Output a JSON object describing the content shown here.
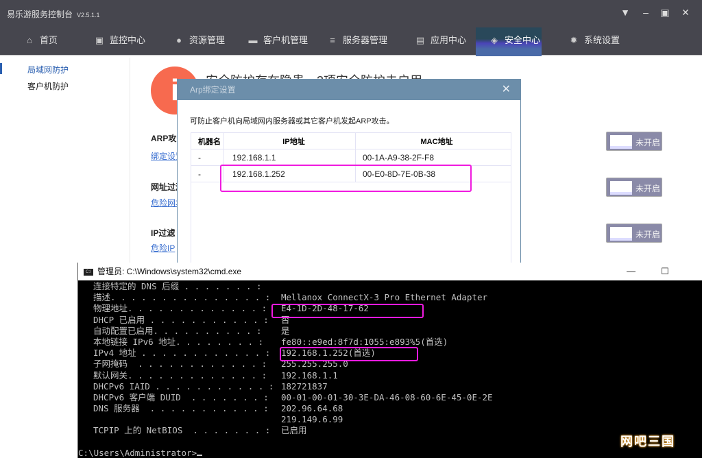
{
  "app": {
    "title": "易乐游服务控制台",
    "version": "V2.5.1.1"
  },
  "nav": [
    {
      "label": "首页",
      "icon": "home-icon"
    },
    {
      "label": "监控中心",
      "icon": "monitor-chart-icon"
    },
    {
      "label": "资源管理",
      "icon": "robot-icon"
    },
    {
      "label": "客户机管理",
      "icon": "computer-icon"
    },
    {
      "label": "服务器管理",
      "icon": "server-icon"
    },
    {
      "label": "应用中心",
      "icon": "bag-icon"
    },
    {
      "label": "安全中心",
      "icon": "shield-icon",
      "active": true
    },
    {
      "label": "系统设置",
      "icon": "gear-icon"
    }
  ],
  "sidebar": [
    {
      "label": "局域网防护",
      "active": true
    },
    {
      "label": "客户机防护"
    }
  ],
  "main": {
    "warning": "安全防护存在隐患，3项安全防护未启用",
    "sections": [
      {
        "title": "ARP攻击防护",
        "link": "绑定设置",
        "toggle": "未开启"
      },
      {
        "title": "网址过滤",
        "link": "危险网址",
        "toggle": "未开启"
      },
      {
        "title": "IP过滤",
        "link": "危险IP",
        "toggle": "未开启"
      }
    ]
  },
  "dialog": {
    "title": "Arp绑定设置",
    "close": "✕",
    "description": "可防止客户机向局域网内服务器或其它客户机发起ARP攻击。",
    "columns": [
      "机器名",
      "IP地址",
      "MAC地址"
    ],
    "rows": [
      {
        "name": "-",
        "ip": "192.168.1.1",
        "mac": "00-1A-A9-38-2F-F8"
      },
      {
        "name": "-",
        "ip": "192.168.1.252",
        "mac": "00-E0-8D-7E-0B-38"
      }
    ]
  },
  "cmd": {
    "title": "管理员: C:\\Windows\\system32\\cmd.exe",
    "lines": [
      {
        "k": "连接特定的 DNS 后缀 . . . . . . . :",
        "v": ""
      },
      {
        "k": "描述. . . . . . . . . . . . . . . :",
        "v": "Mellanox ConnectX-3 Pro Ethernet Adapter"
      },
      {
        "k": "物理地址. . . . . . . . . . . . . :",
        "v": "E4-1D-2D-48-17-62"
      },
      {
        "k": "DHCP 已启用 . . . . . . . . . . . :",
        "v": "否"
      },
      {
        "k": "自动配置已启用. . . . . . . . . . :",
        "v": "是"
      },
      {
        "k": "本地链接 IPv6 地址. . . . . . . . :",
        "v": "fe80::e9ed:8f7d:1055:e893%5(首选)"
      },
      {
        "k": "IPv4 地址 . . . . . . . . . . . . :",
        "v": "192.168.1.252(首选)"
      },
      {
        "k": "子网掩码  . . . . . . . . . . . . :",
        "v": "255.255.255.0"
      },
      {
        "k": "默认网关. . . . . . . . . . . . . :",
        "v": "192.168.1.1"
      },
      {
        "k": "DHCPv6 IAID . . . . . . . . . . . :",
        "v": "182721837"
      },
      {
        "k": "DHCPv6 客户端 DUID  . . . . . . . :",
        "v": "00-01-00-01-30-3E-DA-46-08-60-6E-45-0E-2E"
      },
      {
        "k": "DNS 服务器  . . . . . . . . . . . :",
        "v": "202.96.64.68"
      },
      {
        "k": "",
        "v": "219.149.6.99"
      },
      {
        "k": "TCPIP 上的 NetBIOS  . . . . . . . :",
        "v": "已启用"
      }
    ],
    "prompt": "C:\\Users\\Administrator>"
  },
  "watermark": "网吧三国",
  "colors": {
    "highlight": "#f01adf",
    "titlebar": "#46464e",
    "dialog_header": "#6c8eaa",
    "warning": "#f76a4f"
  }
}
